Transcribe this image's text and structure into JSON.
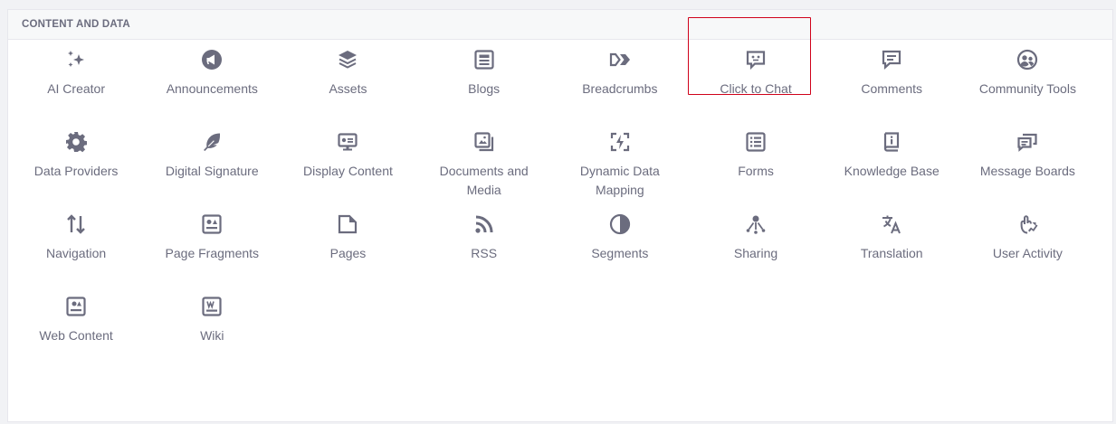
{
  "section": {
    "title": "CONTENT AND DATA"
  },
  "apps": [
    {
      "label": "AI Creator",
      "icon": "sparkles-icon"
    },
    {
      "label": "Announcements",
      "icon": "megaphone-icon"
    },
    {
      "label": "Assets",
      "icon": "layers-icon"
    },
    {
      "label": "Blogs",
      "icon": "blogs-icon"
    },
    {
      "label": "Breadcrumbs",
      "icon": "breadcrumb-icon"
    },
    {
      "label": "Click to Chat",
      "icon": "chat-bot-icon",
      "selected": true
    },
    {
      "label": "Comments",
      "icon": "comment-icon"
    },
    {
      "label": "Community Tools",
      "icon": "community-icon"
    },
    {
      "label": "Data Providers",
      "icon": "gear-icon"
    },
    {
      "label": "Digital Signature",
      "icon": "feather-icon"
    },
    {
      "label": "Display Content",
      "icon": "display-content-icon"
    },
    {
      "label": "Documents and Media",
      "icon": "documents-media-icon"
    },
    {
      "label": "Dynamic Data Mapping",
      "icon": "dynamic-mapping-icon"
    },
    {
      "label": "Forms",
      "icon": "forms-icon"
    },
    {
      "label": "Knowledge Base",
      "icon": "knowledge-base-icon"
    },
    {
      "label": "Message Boards",
      "icon": "message-boards-icon"
    },
    {
      "label": "Navigation",
      "icon": "arrows-up-down-icon"
    },
    {
      "label": "Page Fragments",
      "icon": "page-fragments-icon"
    },
    {
      "label": "Pages",
      "icon": "page-icon"
    },
    {
      "label": "RSS",
      "icon": "rss-icon"
    },
    {
      "label": "Segments",
      "icon": "half-circle-icon"
    },
    {
      "label": "Sharing",
      "icon": "sharing-icon"
    },
    {
      "label": "Translation",
      "icon": "translation-icon"
    },
    {
      "label": "User Activity",
      "icon": "user-activity-icon"
    },
    {
      "label": "Web Content",
      "icon": "web-content-icon"
    },
    {
      "label": "Wiki",
      "icon": "wiki-icon"
    }
  ],
  "colors": {
    "icon": "#6b6c7e",
    "selected_border": "#d0021b",
    "header_bg": "#f7f8f9"
  }
}
